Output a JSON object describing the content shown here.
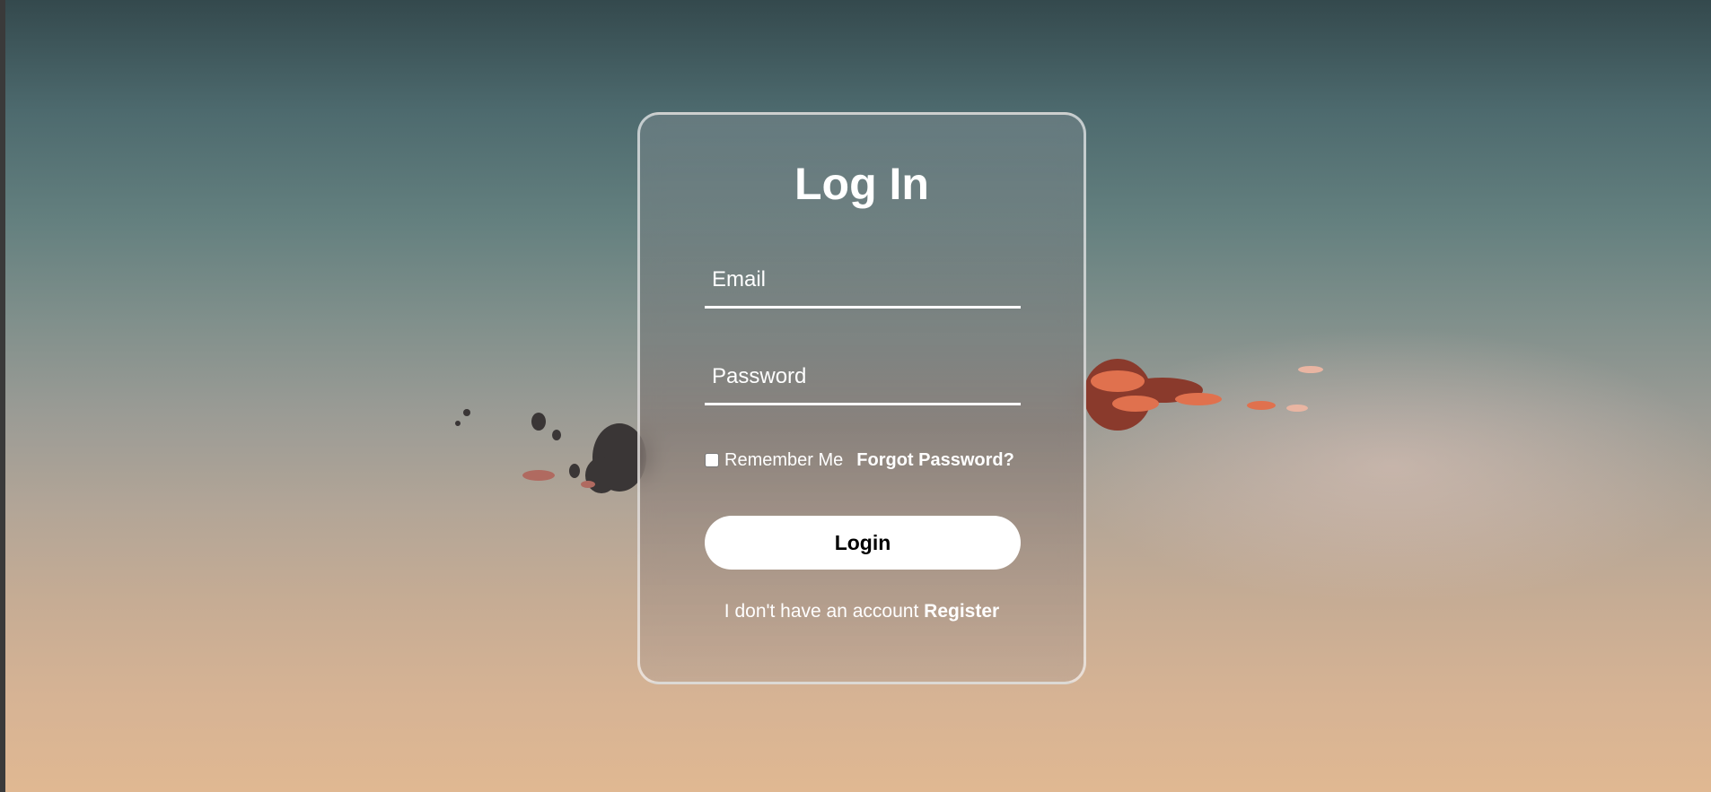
{
  "login_form": {
    "title": "Log In",
    "email_placeholder": "Email",
    "password_placeholder": "Password",
    "remember_label": "Remember Me",
    "remember_checked": false,
    "forgot_label": "Forgot Password?",
    "login_label": "Login",
    "no_account_text": "I don't have an account",
    "register_label": "Register"
  },
  "colors": {
    "card_border": "#ffffff",
    "button_bg": "#ffffff",
    "button_text": "#000000",
    "text": "#ffffff"
  }
}
